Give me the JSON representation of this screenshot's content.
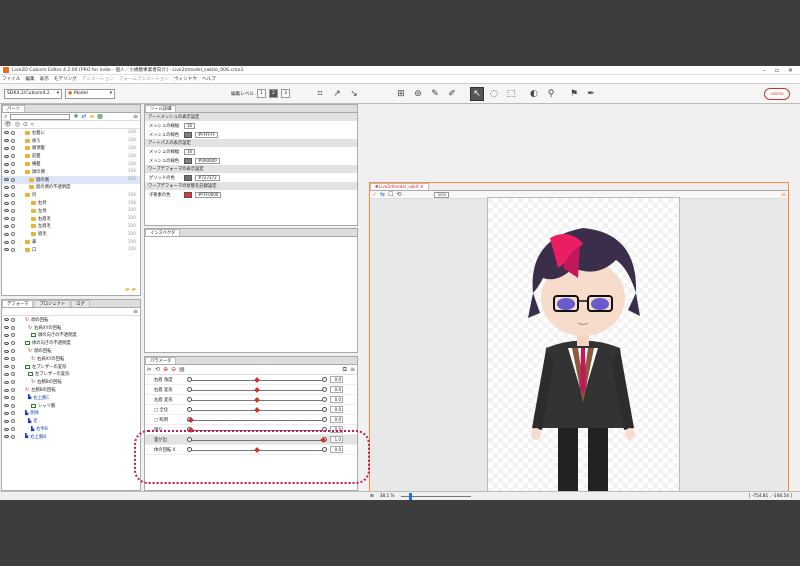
{
  "window": {
    "title": "Live2D Cubism Editor 4.2.00 [PRO for indie - 個人／小規模事業者向け] - Live2dmodel_sakito_006.cmo3"
  },
  "menu": [
    "ファイル",
    "編集",
    "表示",
    "モデリング",
    "アニメーション",
    "フォームアニメーション",
    "ウィンドウ",
    "ヘルプ"
  ],
  "toolbar": {
    "sdk": "SDK4.2/Cubism4.2",
    "mode": "Model",
    "edit_level_label": "編集レベル",
    "levels": [
      "1",
      "2",
      "3"
    ],
    "logo": "nizima"
  },
  "parts_panel": {
    "tab": "パーツ",
    "items": [
      {
        "label": "右髪に",
        "num": "100"
      },
      {
        "label": "後ろ",
        "num": "100"
      },
      {
        "label": "頭頂髪",
        "num": "100"
      },
      {
        "label": "前髪",
        "num": "100"
      },
      {
        "label": "横髪",
        "num": "100"
      },
      {
        "label": "顔の側",
        "num": "100"
      },
      {
        "label": "眉の側",
        "num": "100"
      },
      {
        "label": "眉の側の不透明度",
        "num": ""
      },
      {
        "label": "目",
        "num": "100"
      },
      {
        "label": "右目",
        "num": "100"
      },
      {
        "label": "左目",
        "num": "100"
      },
      {
        "label": "右眉毛",
        "num": "100"
      },
      {
        "label": "左眉毛",
        "num": "100"
      },
      {
        "label": "眉毛",
        "num": "100"
      },
      {
        "label": "鼻",
        "num": "100"
      },
      {
        "label": "口",
        "num": "100"
      }
    ],
    "selected_num": "1.00"
  },
  "deformer_panel": {
    "tabs": [
      "デフォーマ",
      "プロジェクト",
      "ログ"
    ],
    "items": [
      {
        "label": "顔の回転",
        "type": "rot"
      },
      {
        "label": "右肩XYの回転",
        "type": "rot"
      },
      {
        "label": "顔の向きの不透明度",
        "type": "warp"
      },
      {
        "label": "体の向きの不透明度",
        "type": "warp"
      },
      {
        "label": "顔の回転",
        "type": "rot"
      },
      {
        "label": "右肩XYの回転",
        "type": "rot"
      },
      {
        "label": "左ブレザーの変形",
        "type": "warp"
      },
      {
        "label": "左ブレザーの変形",
        "type": "warp"
      },
      {
        "label": "右腕Bの回転",
        "type": "rot"
      },
      {
        "label": "左腕Bの回転",
        "type": "rot"
      },
      {
        "label": "右上腕C",
        "type": "blue"
      },
      {
        "label": "シャツ腕",
        "type": "warp"
      },
      {
        "label": "胴体",
        "type": "blue"
      },
      {
        "label": "足",
        "type": "blue"
      },
      {
        "label": "右手B",
        "type": "blue"
      },
      {
        "label": "右上腕B",
        "type": "blue"
      }
    ]
  },
  "tool_detail": {
    "tab": "ツール詳細",
    "groups": [
      {
        "head": "アートメッシュの表示設定",
        "rows": [
          {
            "label": "メッシュの線幅",
            "value": "16"
          },
          {
            "label": "メッシュの線色",
            "value": "#FFFFFF",
            "color": "#808080"
          }
        ]
      },
      {
        "head": "アートパスの表示設定",
        "rows": [
          {
            "label": "メッシュの線幅",
            "value": "16"
          },
          {
            "label": "メッシュの線色",
            "value": "#000000",
            "color": "#808080"
          }
        ]
      },
      {
        "head": "ワープデフォーマの表示設定",
        "rows": [
          {
            "label": "グリッドの色",
            "value": "#727272",
            "color": "#727272"
          }
        ]
      },
      {
        "head": "ワープデフォーマの状態を記録設定",
        "rows": [
          {
            "label": "子要素の色",
            "value": "#FFF0000",
            "color": "#e53935"
          }
        ]
      }
    ]
  },
  "inspector": {
    "tab": "インスペクタ"
  },
  "parameters": {
    "tab": "パラメータ",
    "items": [
      {
        "label": "右眉 角度",
        "value": "0.0",
        "knob": 0.5,
        "star": true
      },
      {
        "label": "右眉 変形",
        "value": "0.0",
        "knob": 0.5,
        "star": true
      },
      {
        "label": "左眉 変形",
        "value": "0.0",
        "knob": 0.5,
        "star": true
      },
      {
        "label": "□ 全化",
        "value": "0.0",
        "knob": 0.5,
        "star": false
      },
      {
        "label": "□ 照明",
        "value": "0.0",
        "knob": 0.0,
        "star": false
      },
      {
        "label": "明り",
        "value": "0.0",
        "knob": 0.0,
        "star": true
      },
      {
        "label": "雲が出",
        "value": "1.0",
        "knob": 1.0,
        "star": true
      },
      {
        "label": "体の回転 X",
        "value": "0.0",
        "knob": 0.5,
        "star": true
      }
    ]
  },
  "canvas": {
    "tab": "Live2dmodel_sakit",
    "solo": "Solo",
    "zoom": "38.1 %"
  },
  "status": {
    "coords": "[ -754.81 , -108.54 ]"
  },
  "colors": {
    "accent": "#ff8a3d",
    "highlight": "#c2185b"
  }
}
